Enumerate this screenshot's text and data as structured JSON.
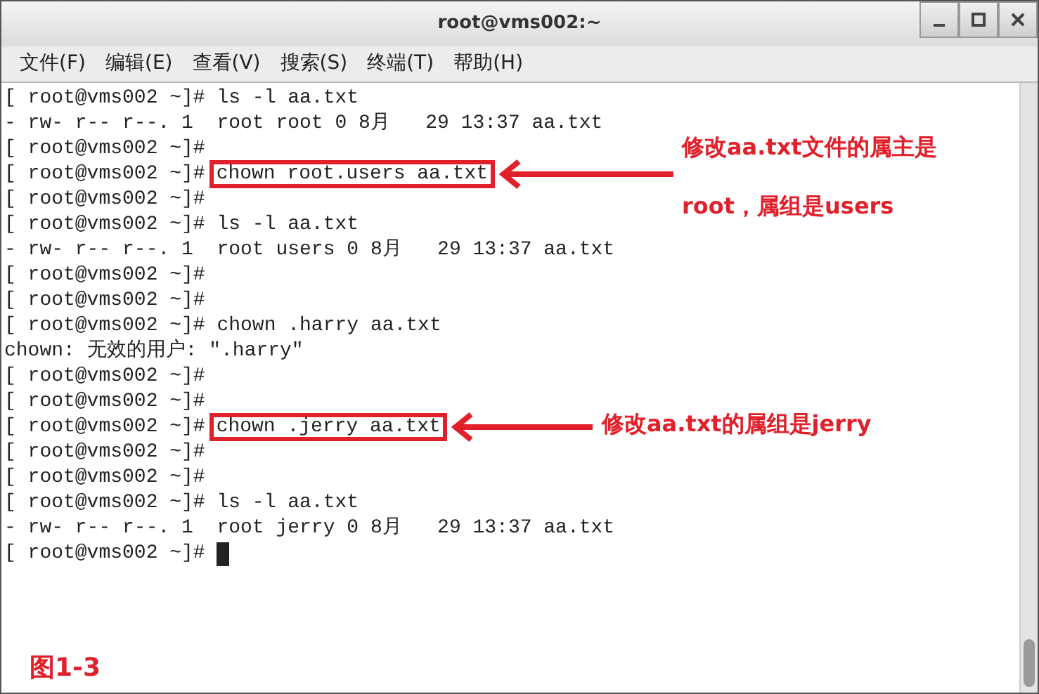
{
  "window": {
    "title": "root@vms002:~"
  },
  "menu": [
    "文件(F)",
    "编辑(E)",
    "查看(V)",
    "搜索(S)",
    "终端(T)",
    "帮助(H)"
  ],
  "terminal": {
    "lines": [
      {
        "kind": "prompt",
        "prompt": "[ root@vms002 ~]#",
        "command": "ls -l aa.txt",
        "highlighted": false
      },
      {
        "kind": "output",
        "text": "- rw- r-- r--. 1  root root 0 8月   29 13:37 aa.txt"
      },
      {
        "kind": "prompt",
        "prompt": "[ root@vms002 ~]#",
        "highlighted": false
      },
      {
        "kind": "prompt",
        "prompt": "[ root@vms002 ~]#",
        "command": "chown root.users aa.txt",
        "highlighted": true
      },
      {
        "kind": "prompt",
        "prompt": "[ root@vms002 ~]#",
        "highlighted": false
      },
      {
        "kind": "prompt",
        "prompt": "[ root@vms002 ~]#",
        "command": "ls -l aa.txt",
        "highlighted": false
      },
      {
        "kind": "output",
        "text": "- rw- r-- r--. 1  root users 0 8月   29 13:37 aa.txt"
      },
      {
        "kind": "prompt",
        "prompt": "[ root@vms002 ~]#",
        "highlighted": false
      },
      {
        "kind": "prompt",
        "prompt": "[ root@vms002 ~]#",
        "highlighted": false
      },
      {
        "kind": "prompt",
        "prompt": "[ root@vms002 ~]#",
        "command": "chown .harry aa.txt",
        "highlighted": false
      },
      {
        "kind": "output",
        "text": "chown: 无效的用户: \".harry\""
      },
      {
        "kind": "prompt",
        "prompt": "[ root@vms002 ~]#",
        "highlighted": false
      },
      {
        "kind": "prompt",
        "prompt": "[ root@vms002 ~]#",
        "highlighted": false
      },
      {
        "kind": "prompt",
        "prompt": "[ root@vms002 ~]#",
        "command": "chown .jerry aa.txt",
        "highlighted": true
      },
      {
        "kind": "prompt",
        "prompt": "[ root@vms002 ~]#",
        "highlighted": false
      },
      {
        "kind": "prompt",
        "prompt": "[ root@vms002 ~]#",
        "highlighted": false
      },
      {
        "kind": "prompt",
        "prompt": "[ root@vms002 ~]#",
        "command": "ls -l aa.txt",
        "highlighted": false
      },
      {
        "kind": "output",
        "text": "- rw- r-- r--. 1  root jerry 0 8月   29 13:37 aa.txt"
      },
      {
        "kind": "prompt",
        "prompt": "[ root@vms002 ~]#",
        "highlighted": false,
        "cursor": true
      }
    ]
  },
  "annotations": [
    {
      "lines": [
        "修改aa.txt文件的属主是",
        "root，属组是users"
      ]
    },
    {
      "lines": [
        "修改aa.txt的属组是jerry"
      ]
    }
  ],
  "figure_label": "图1-3"
}
